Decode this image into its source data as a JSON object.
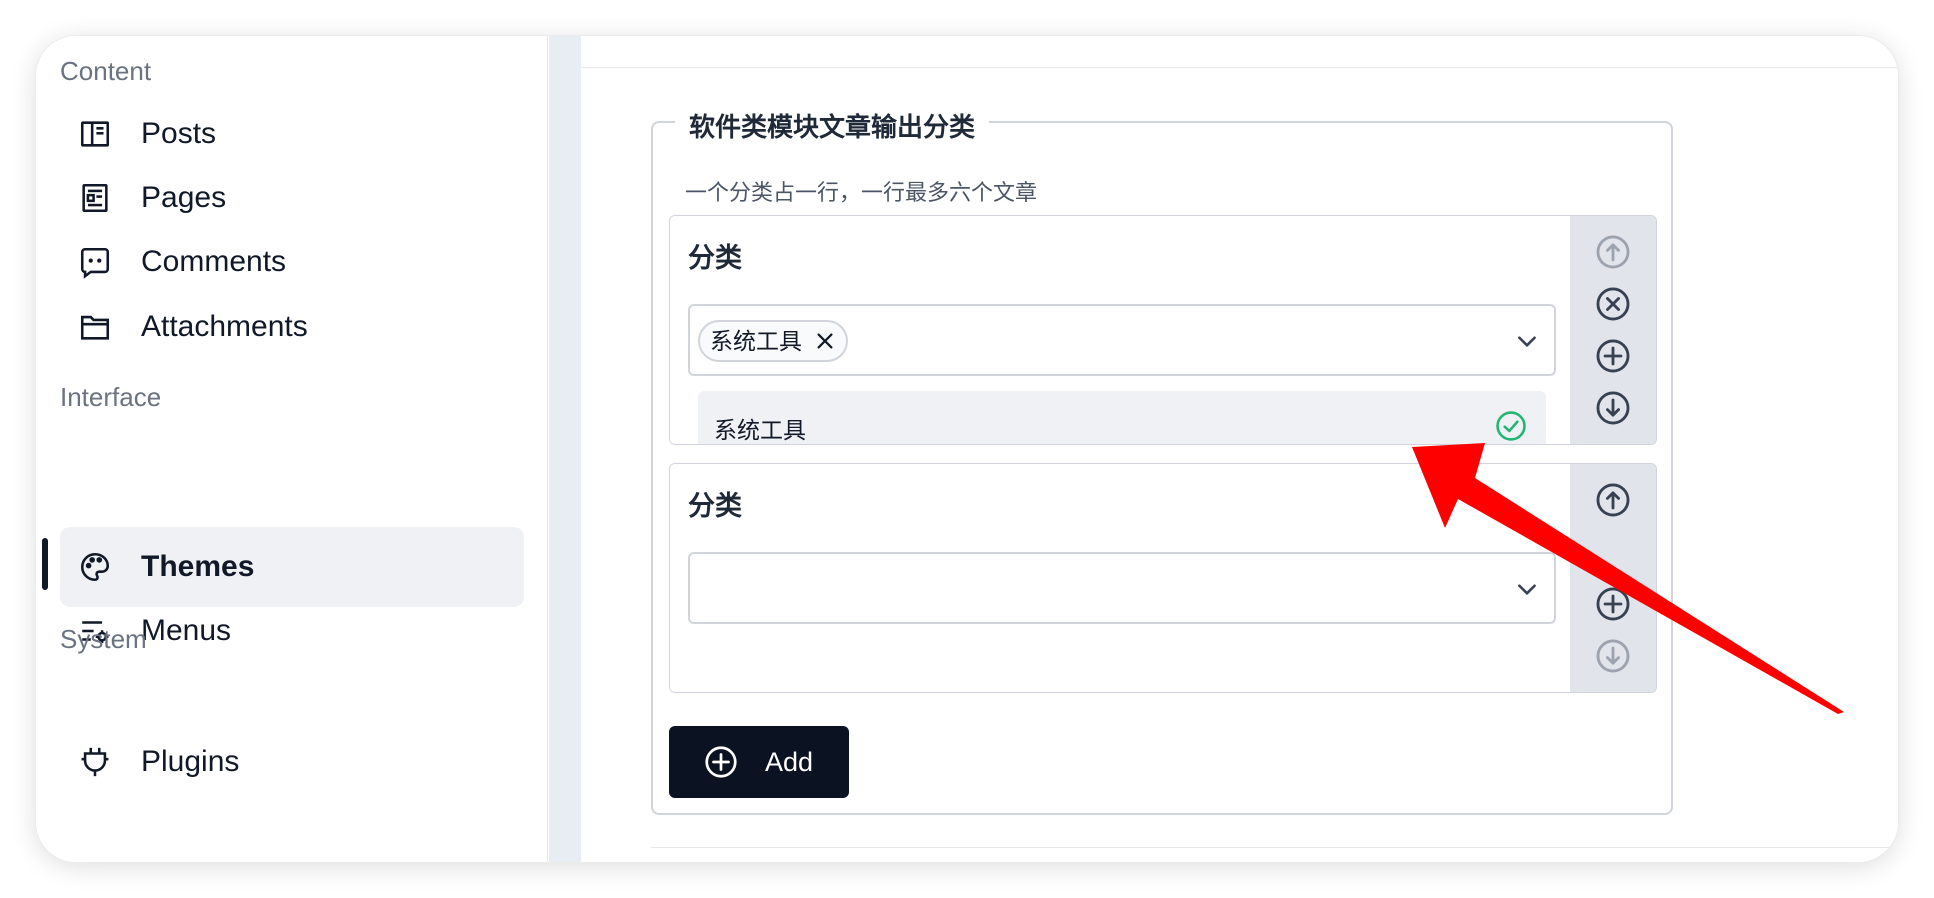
{
  "sidebar": {
    "sections": [
      {
        "label": "Content"
      },
      {
        "label": "Interface"
      },
      {
        "label": "System"
      }
    ],
    "items": [
      {
        "label": "Posts",
        "icon": "posts-icon"
      },
      {
        "label": "Pages",
        "icon": "pages-icon"
      },
      {
        "label": "Comments",
        "icon": "comments-icon"
      },
      {
        "label": "Attachments",
        "icon": "attachments-icon"
      },
      {
        "label": "Themes",
        "icon": "palette-icon",
        "active": true
      },
      {
        "label": "Menus",
        "icon": "menus-icon"
      },
      {
        "label": "Plugins",
        "icon": "plug-icon"
      }
    ]
  },
  "form": {
    "legend": "软件类模块文章输出分类",
    "help": "一个分类占一行，一行最多六个文章",
    "repeaters": [
      {
        "field_label": "分类",
        "selected_tags": [
          "系统工具"
        ],
        "dropdown_option": "系统工具",
        "dropdown_option_selected": true
      },
      {
        "field_label": "分类",
        "selected_tags": []
      }
    ],
    "add_label": "Add"
  },
  "colors": {
    "accent_dark": "#0b1221",
    "check_green": "#22b573",
    "annotation_arrow": "#ff0000"
  }
}
